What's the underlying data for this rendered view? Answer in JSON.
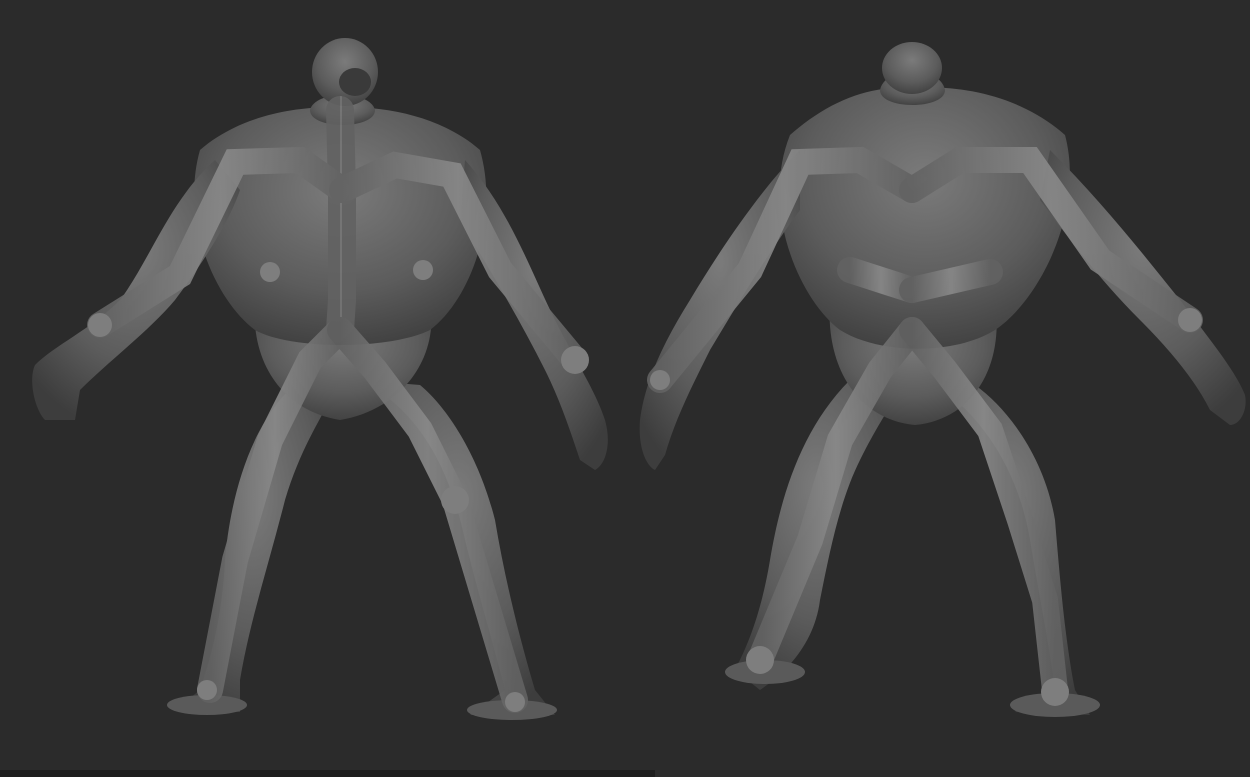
{
  "scene": {
    "background_color": "#2b2b2b",
    "model_color": "#6e6e6e",
    "bone_color": "#7a7a7a",
    "views": [
      {
        "name": "front-view"
      },
      {
        "name": "back-view"
      }
    ]
  }
}
